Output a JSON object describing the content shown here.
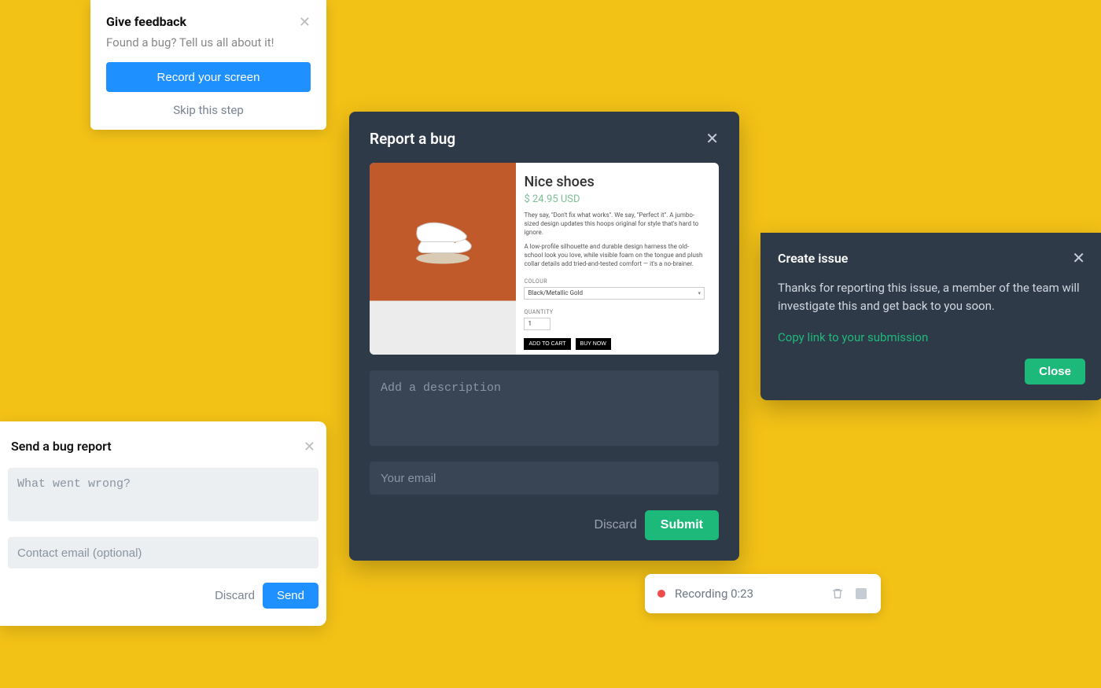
{
  "feedback": {
    "title": "Give feedback",
    "subtitle": "Found a bug? Tell us all about it!",
    "record_label": "Record your screen",
    "skip_label": "Skip this step"
  },
  "report": {
    "title": "Report a bug",
    "screenshot": {
      "product_name": "Nice shoes",
      "price": "$ 24.95 USD",
      "copy1": "They say, \"Don't fix what works\". We say, \"Perfect it\". A jumbo-sized design updates this hoops original for style that's hard to ignore.",
      "copy2": "A low-profile silhouette and durable design harness the old-school look you love, while visible foam on the tongue and plush collar details add tried-and-tested comfort — it's a no-brainer.",
      "colour_label": "COLOUR",
      "colour_value": "Black/Metallic Gold",
      "quantity_label": "QUANTITY",
      "quantity_value": "1",
      "add_to_cart": "ADD TO CART",
      "buy_now": "BUY NOW"
    },
    "desc_placeholder": "Add a description",
    "email_placeholder": "Your email",
    "discard_label": "Discard",
    "submit_label": "Submit"
  },
  "issue": {
    "title": "Create issue",
    "body": "Thanks for reporting this issue, a member of the team will investigate this and get back to you soon.",
    "link_label": "Copy link to your submission",
    "close_label": "Close"
  },
  "send": {
    "title": "Send a bug report",
    "what_placeholder": "What went wrong?",
    "email_placeholder": "Contact email (optional)",
    "discard_label": "Discard",
    "send_label": "Send"
  },
  "recording": {
    "label": "Recording 0:23"
  }
}
